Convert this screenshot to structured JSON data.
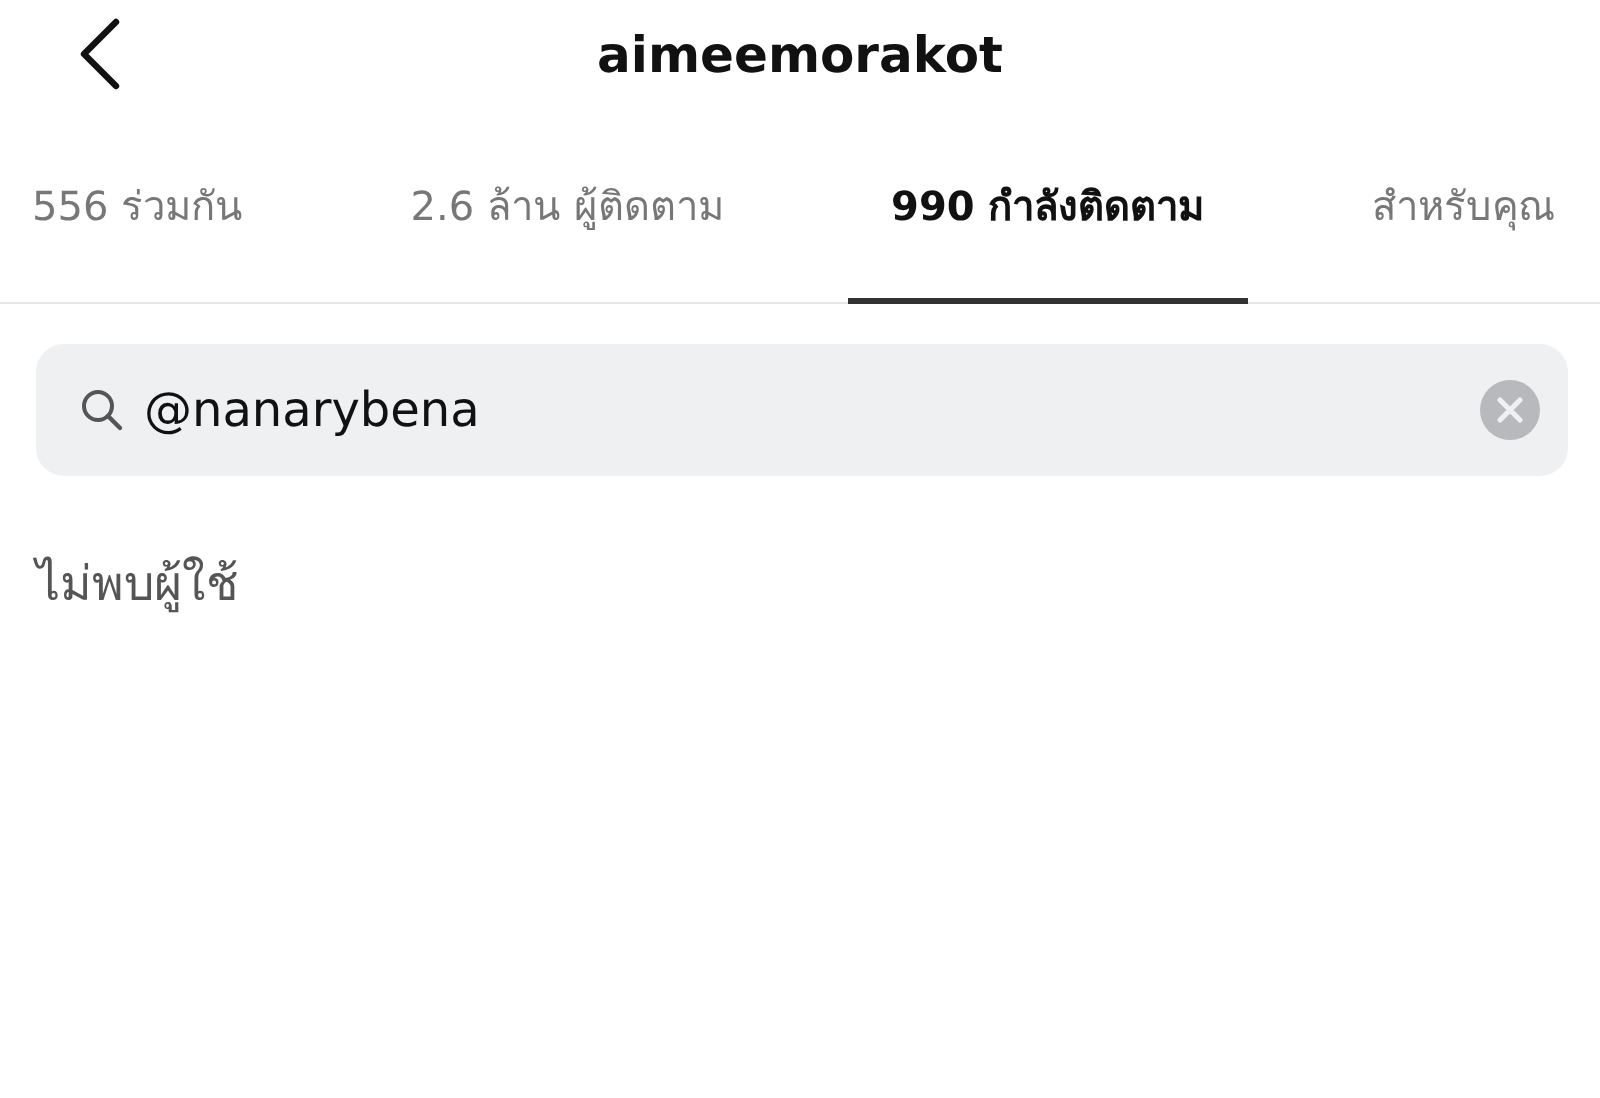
{
  "header": {
    "title": "aimeemorakot"
  },
  "tabs": [
    {
      "label": "556 ร่วมกัน",
      "selected": false
    },
    {
      "label": "2.6 ล้าน ผู้ติดตาม",
      "selected": false
    },
    {
      "label": "990 กำลังติดตาม",
      "selected": true
    },
    {
      "label": "สำหรับคุณ",
      "selected": false
    }
  ],
  "search": {
    "value": "@nanarybena"
  },
  "message": "ไม่พบผู้ใช้"
}
